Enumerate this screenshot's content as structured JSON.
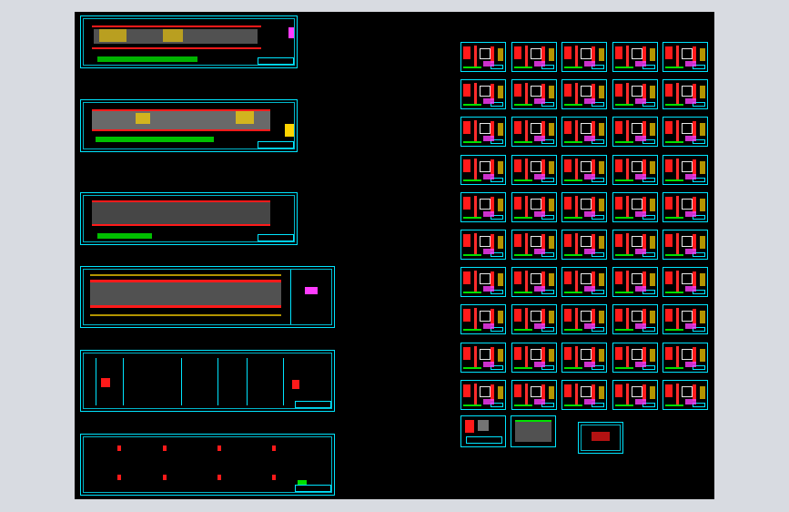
{
  "viewport": {
    "background_color": "#d8dbe1",
    "drawing_background": "#000000"
  },
  "colors": {
    "sheet_border": "#00e5ff",
    "dimension": "#ff1a1a",
    "text": "#e8e8e8",
    "annotation": "#00e000",
    "highlight": "#ffd400",
    "accent": "#ff3cff"
  },
  "sheets_left": [
    {
      "kind": "strip-plan"
    },
    {
      "kind": "strip-plan-dense"
    },
    {
      "kind": "strip-plan-light"
    },
    {
      "kind": "framing-plan"
    },
    {
      "kind": "column-elevation"
    },
    {
      "kind": "pier-layout"
    }
  ],
  "detail_grid": {
    "rows": 10,
    "cols": 5
  },
  "bottom_sheets": [
    {
      "kind": "detail"
    },
    {
      "kind": "schedule-table"
    },
    {
      "kind": "title-block"
    }
  ]
}
